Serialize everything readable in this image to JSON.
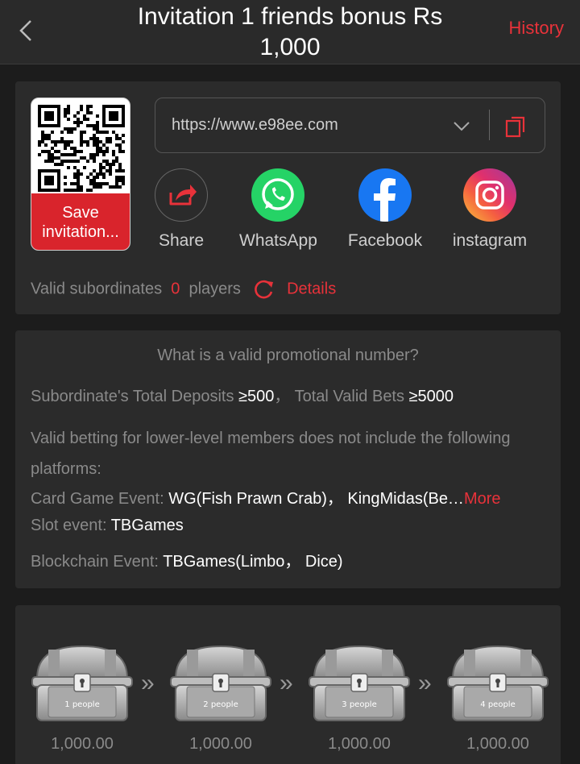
{
  "header": {
    "title_line1": "Invitation 1 friends bonus Rs",
    "title_line2": "1,000",
    "history_label": "History"
  },
  "invite": {
    "save_label": "Save invitation...",
    "url": "https://www.e98ee.com",
    "share": [
      {
        "label": "Share",
        "icon": "share-icon"
      },
      {
        "label": "WhatsApp",
        "icon": "whatsapp-icon"
      },
      {
        "label": "Facebook",
        "icon": "facebook-icon"
      },
      {
        "label": "instagram",
        "icon": "instagram-icon"
      }
    ],
    "valid_label": "Valid subordinates",
    "valid_count": "0",
    "valid_unit": "players",
    "details_label": "Details"
  },
  "promo": {
    "question": "What is a valid promotional number?",
    "deposits_label": "Subordinate's Total Deposits",
    "deposits_value": "≥500",
    "sep": "，",
    "bets_label": "Total Valid Bets",
    "bets_value": "≥5000",
    "note": "Valid betting for lower-level members does not include the following",
    "note2": "platforms:",
    "card_label": "Card Game Event:",
    "card_value": "WG(Fish Prawn Crab)， KingMidas(Be…",
    "more_label": "More",
    "slot_label": "Slot event:",
    "slot_value": "TBGames",
    "chain_label": "Blockchain Event:",
    "chain_value": "TBGames(Limbo， Dice)"
  },
  "chests": [
    {
      "label": "1 people",
      "amount": "1,000.00"
    },
    {
      "label": "2 people",
      "amount": "1,000.00"
    },
    {
      "label": "3 people",
      "amount": "1,000.00"
    },
    {
      "label": "4 people",
      "amount": "1,000.00"
    }
  ],
  "colors": {
    "accent": "#e8323a",
    "background": "#1c1c1c",
    "card": "#2b2b2b"
  }
}
